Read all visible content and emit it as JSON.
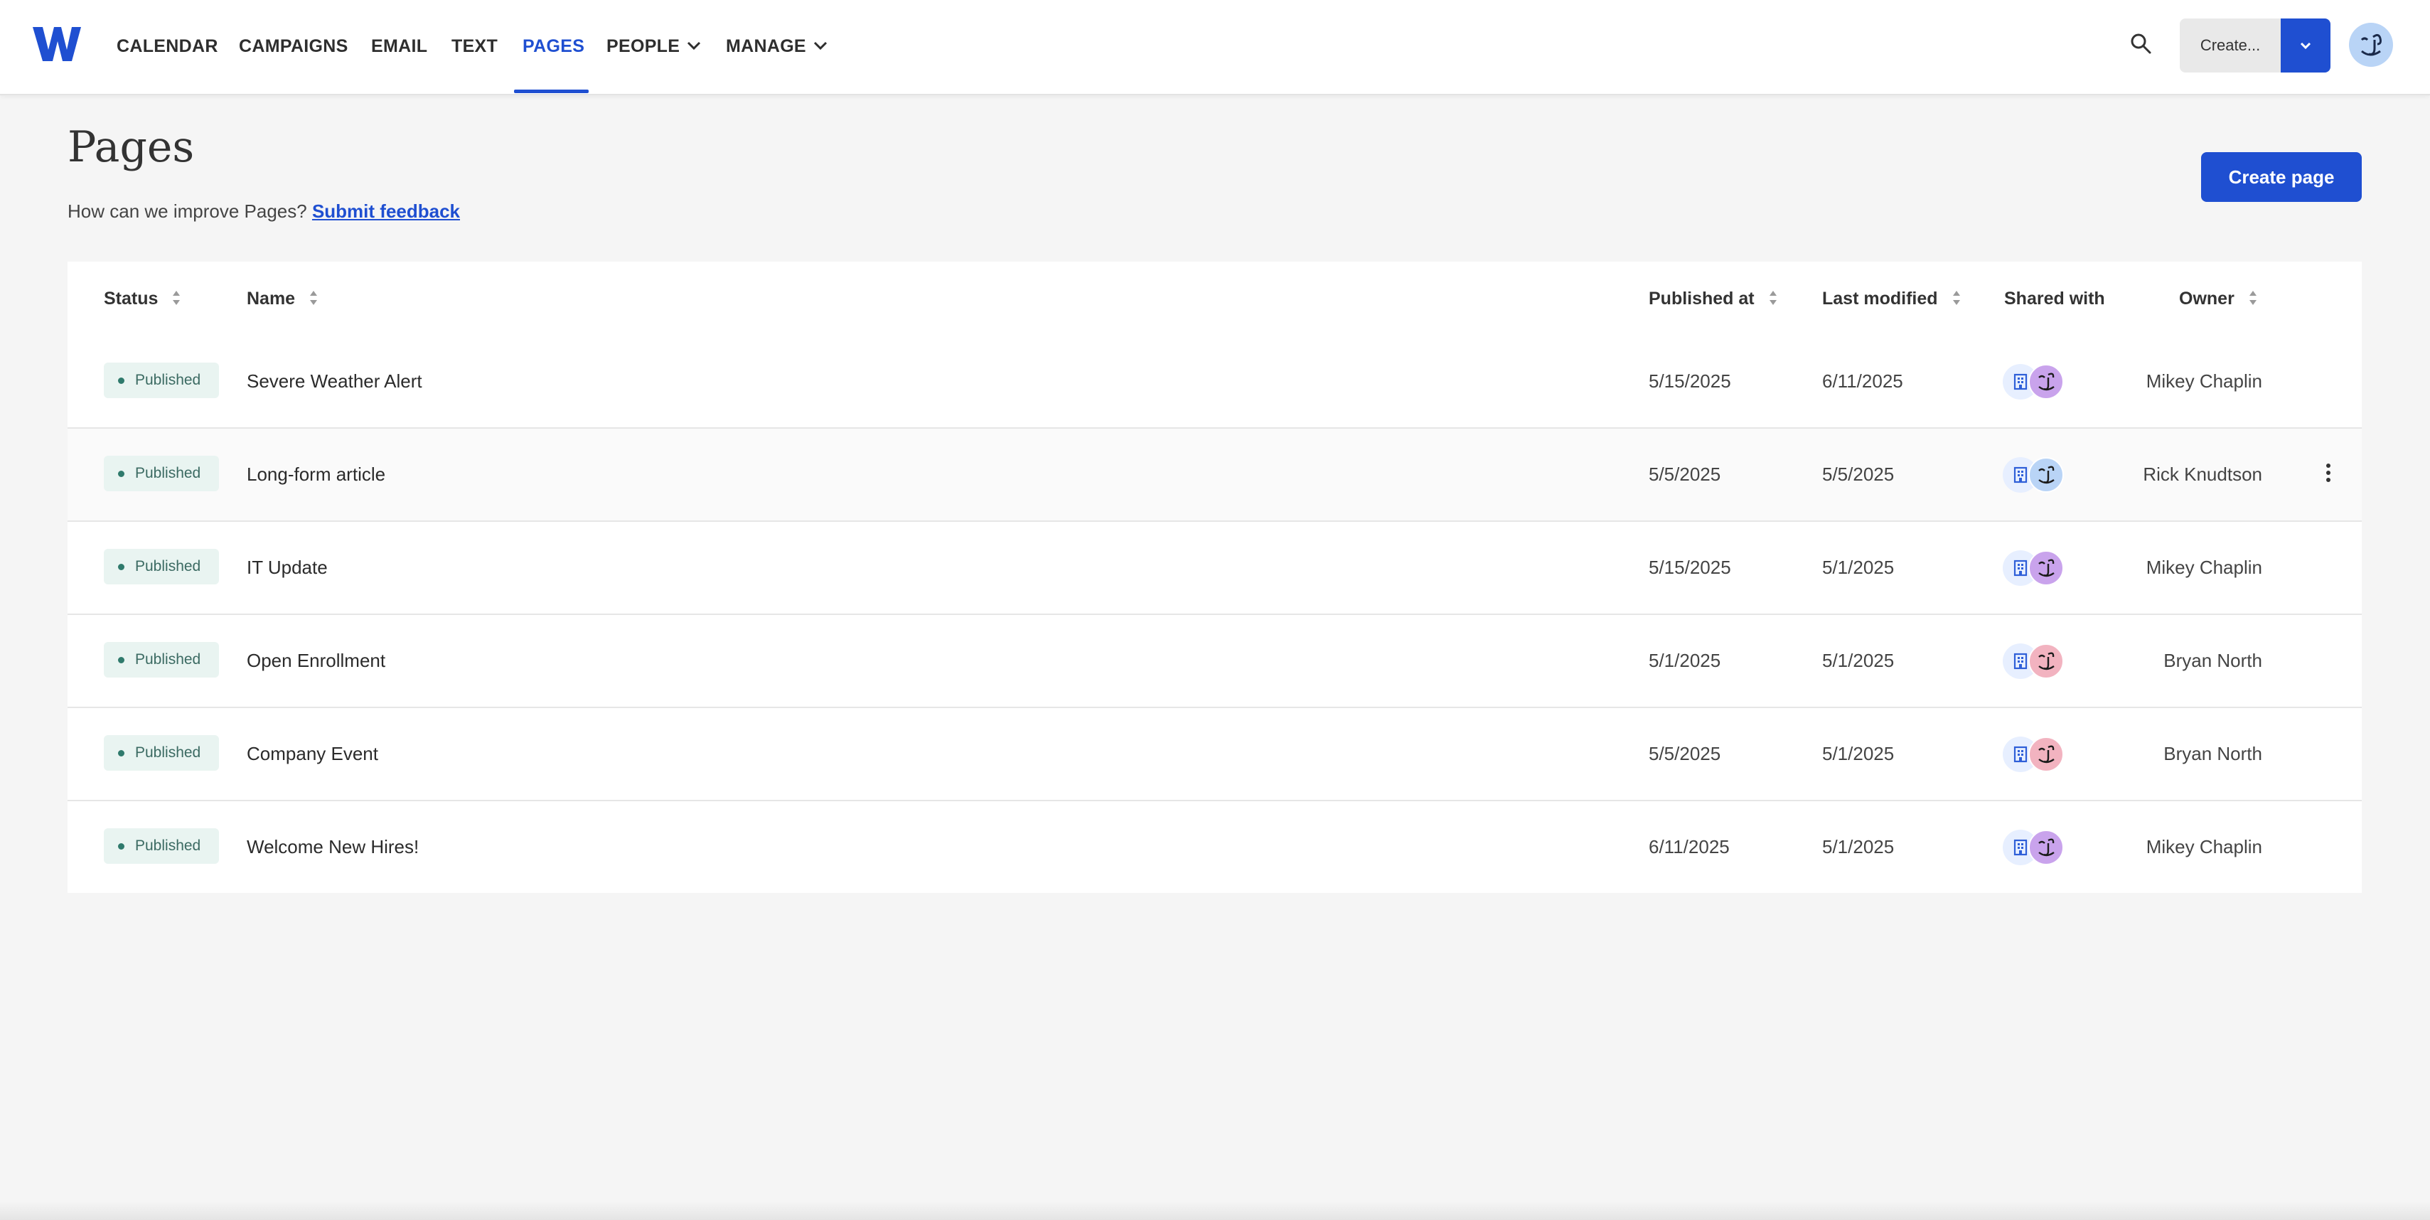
{
  "nav": {
    "items": [
      {
        "label": "CALENDAR"
      },
      {
        "label": "CAMPAIGNS"
      },
      {
        "label": "EMAIL"
      },
      {
        "label": "TEXT"
      },
      {
        "label": "PAGES",
        "active": true
      },
      {
        "label": "PEOPLE",
        "dropdown": true
      },
      {
        "label": "MANAGE",
        "dropdown": true
      }
    ],
    "create_label": "Create...",
    "accent": "#1f4fd1"
  },
  "header": {
    "title": "Pages",
    "feedback_text": "How can we improve Pages?",
    "feedback_link": "Submit feedback",
    "create_button": "Create page"
  },
  "table": {
    "columns": {
      "status": "Status",
      "name": "Name",
      "published_at": "Published at",
      "last_modified": "Last modified",
      "shared_with": "Shared with",
      "owner": "Owner"
    },
    "rows": [
      {
        "status": "Published",
        "name": "Severe Weather Alert",
        "published_at": "5/15/2025",
        "last_modified": "6/11/2025",
        "owner": "Mikey Chaplin",
        "avatar_color": "#c9a3ec"
      },
      {
        "status": "Published",
        "name": "Long-form article",
        "published_at": "5/5/2025",
        "last_modified": "5/5/2025",
        "owner": "Rick Knudtson",
        "avatar_color": "#b9d4f6"
      },
      {
        "status": "Published",
        "name": "IT Update",
        "published_at": "5/15/2025",
        "last_modified": "5/1/2025",
        "owner": "Mikey Chaplin",
        "avatar_color": "#c9a3ec"
      },
      {
        "status": "Published",
        "name": "Open Enrollment",
        "published_at": "5/1/2025",
        "last_modified": "5/1/2025",
        "owner": "Bryan North",
        "avatar_color": "#f2b3c0"
      },
      {
        "status": "Published",
        "name": "Company Event",
        "published_at": "5/5/2025",
        "last_modified": "5/1/2025",
        "owner": "Bryan North",
        "avatar_color": "#f2b3c0"
      },
      {
        "status": "Published",
        "name": "Welcome New Hires!",
        "published_at": "6/11/2025",
        "last_modified": "5/1/2025",
        "owner": "Mikey Chaplin",
        "avatar_color": "#c9a3ec"
      }
    ]
  }
}
